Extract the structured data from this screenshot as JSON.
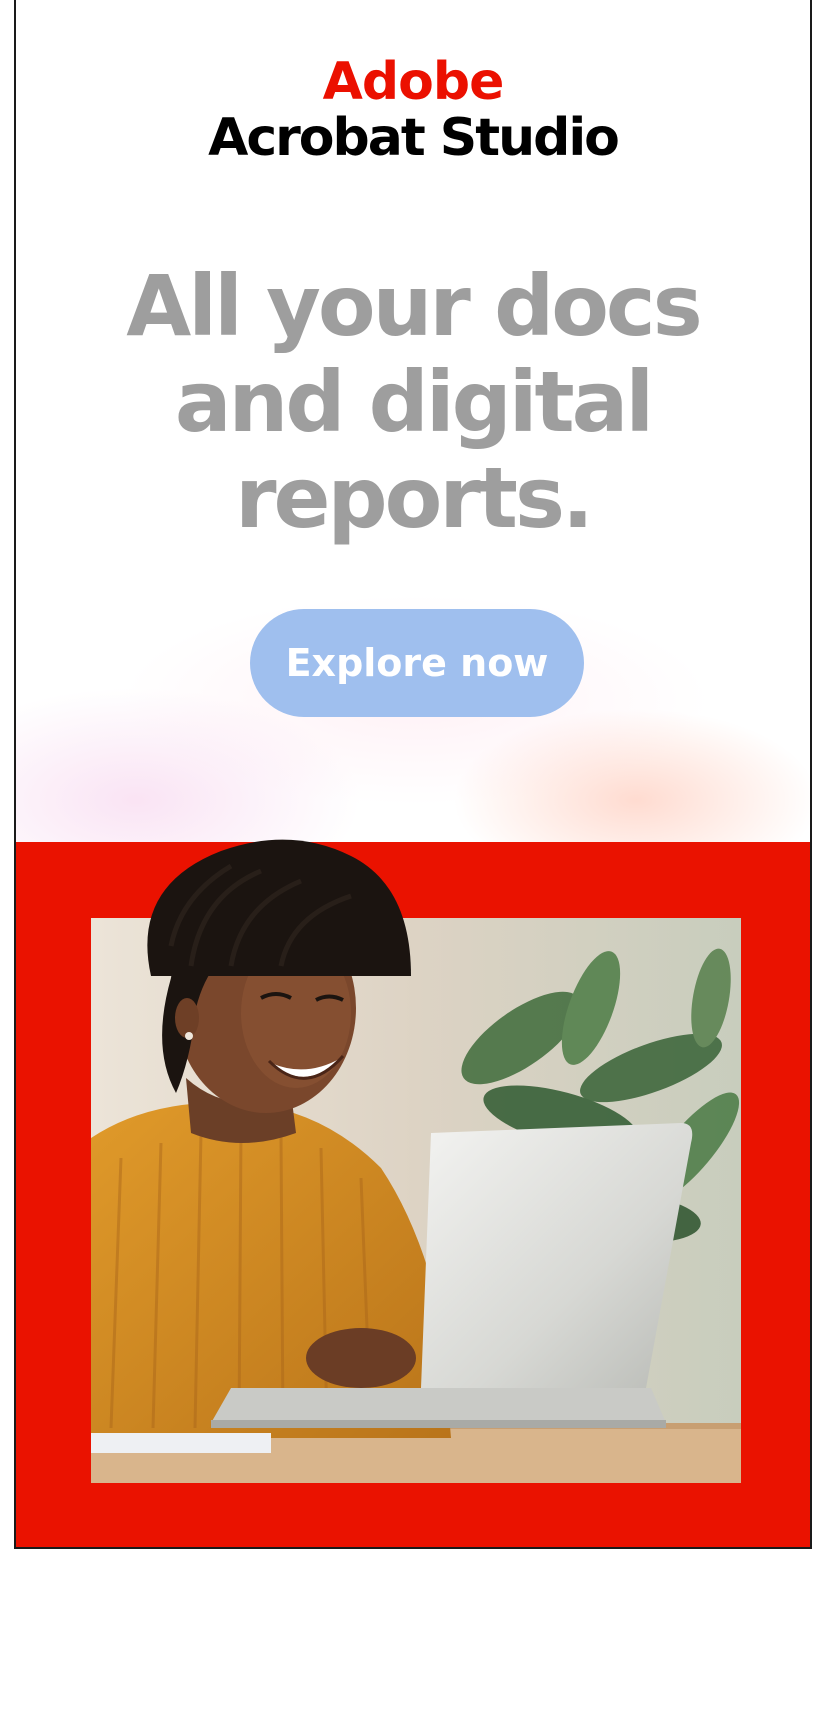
{
  "brand": {
    "company": "Adobe",
    "product": "Acrobat Studio",
    "accent_color": "#eb1000"
  },
  "headline": {
    "lines": [
      "All your docs",
      "and digital",
      "reports."
    ],
    "color": "#9e9e9e"
  },
  "cta": {
    "label": "Explore now",
    "background": "#9fbfee"
  },
  "hero": {
    "panel_color": "#ea1200"
  }
}
